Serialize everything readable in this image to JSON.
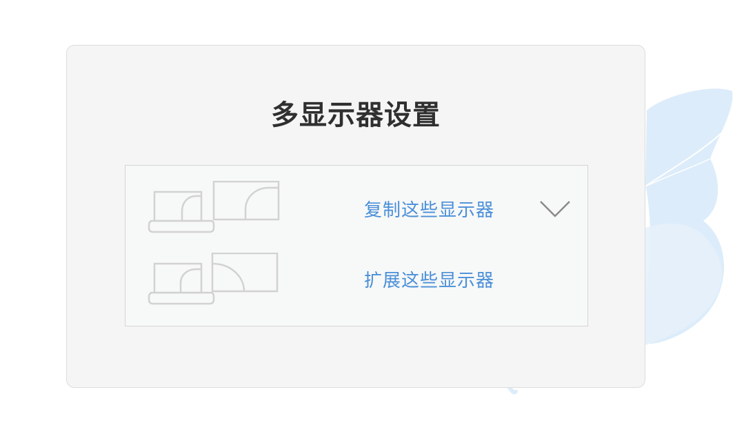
{
  "dialog": {
    "title": "多显示器设置"
  },
  "options": [
    {
      "label": "复制这些显示器",
      "icon": "duplicate-displays-icon",
      "selected": true
    },
    {
      "label": "扩展这些显示器",
      "icon": "extend-displays-icon",
      "selected": false
    }
  ],
  "colors": {
    "accent": "#4a8fd8",
    "title": "#2f2f2f",
    "card_bg": "#f5f5f5",
    "leaf": "#dcecfa"
  }
}
